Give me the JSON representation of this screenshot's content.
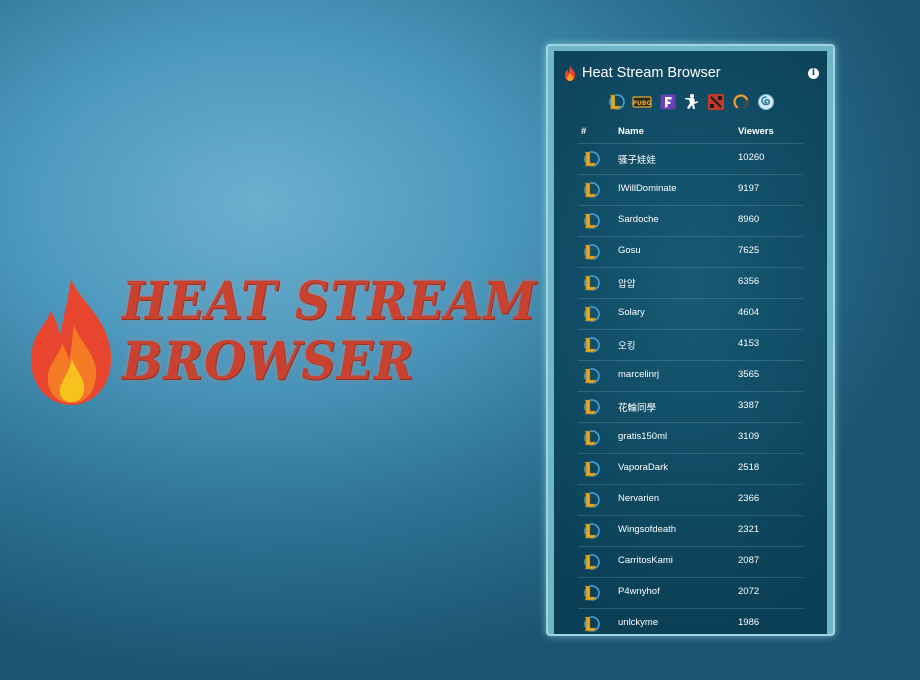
{
  "hero": {
    "line1": "HEAT STREAM",
    "line2": "BROWSER",
    "color": "#c9422f"
  },
  "popup": {
    "title": "Heat Stream Browser",
    "info_icon": "i",
    "games": [
      {
        "name": "League of Legends",
        "icon": "league-of-legends-icon"
      },
      {
        "name": "PUBG",
        "icon": "pubg-icon"
      },
      {
        "name": "Fortnite",
        "icon": "fortnite-icon"
      },
      {
        "name": "Counter-Strike",
        "icon": "counter-strike-icon"
      },
      {
        "name": "Dota 2",
        "icon": "dota2-icon"
      },
      {
        "name": "Overwatch",
        "icon": "overwatch-icon"
      },
      {
        "name": "Hearthstone",
        "icon": "hearthstone-icon"
      }
    ],
    "columns": {
      "rank": "#",
      "name": "Name",
      "viewers": "Viewers"
    },
    "streams": [
      {
        "name": "骚子娃娃",
        "viewers": "10260"
      },
      {
        "name": "IWillDominate",
        "viewers": "9197"
      },
      {
        "name": "Sardoche",
        "viewers": "8960"
      },
      {
        "name": "Gosu",
        "viewers": "7625"
      },
      {
        "name": "압얍",
        "viewers": "6356"
      },
      {
        "name": "Solary",
        "viewers": "4604"
      },
      {
        "name": "오킹",
        "viewers": "4153"
      },
      {
        "name": "marcelinrj",
        "viewers": "3565"
      },
      {
        "name": "花輪同學",
        "viewers": "3387"
      },
      {
        "name": "gratis150ml",
        "viewers": "3109"
      },
      {
        "name": "VaporaDark",
        "viewers": "2518"
      },
      {
        "name": "Nervarien",
        "viewers": "2366"
      },
      {
        "name": "Wingsofdeath",
        "viewers": "2321"
      },
      {
        "name": "CarritosKami",
        "viewers": "2087"
      },
      {
        "name": "P4wnyhof",
        "viewers": "2072"
      },
      {
        "name": "unlckyme",
        "viewers": "1986"
      }
    ],
    "accent_gold": "#e0a92a",
    "panel_bg": "#0f4a62"
  }
}
